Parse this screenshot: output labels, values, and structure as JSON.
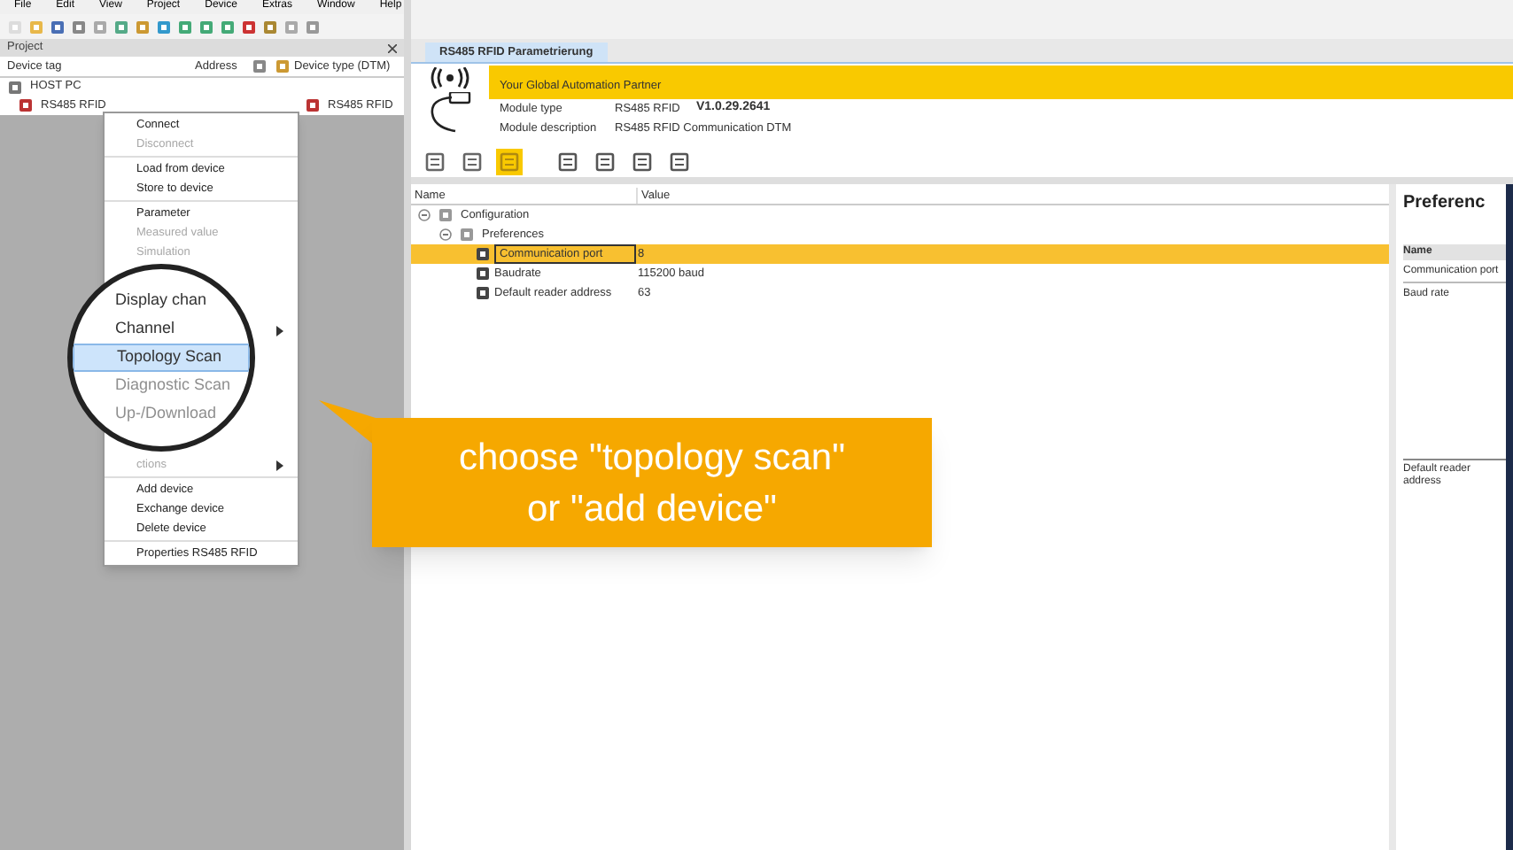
{
  "menu_bar": [
    "File",
    "Edit",
    "View",
    "Project",
    "Device",
    "Extras",
    "Window",
    "Help"
  ],
  "project_panel": {
    "title": "Project",
    "columns": [
      "Device tag",
      "Address",
      "Device type (DTM)"
    ],
    "tree": [
      {
        "tag": "HOST PC",
        "children": [
          {
            "tag": "RS485 RFID",
            "device_type": "RS485 RFID"
          }
        ]
      }
    ]
  },
  "context_menu": {
    "groups": [
      [
        {
          "label": "Connect",
          "disabled": false
        },
        {
          "label": "Disconnect",
          "disabled": true
        }
      ],
      [
        {
          "label": "Load from device",
          "disabled": false
        },
        {
          "label": "Store to device",
          "disabled": false
        }
      ],
      [
        {
          "label": "Parameter",
          "disabled": false
        },
        {
          "label": "Measured value",
          "disabled": true
        },
        {
          "label": "Simulation",
          "disabled": true
        }
      ]
    ],
    "hidden_row_submenu": true,
    "lower_groups": [
      [
        {
          "label": "ctions",
          "disabled": true,
          "submenu": true
        }
      ],
      [
        {
          "label": "Add device",
          "disabled": false
        },
        {
          "label": "Exchange device",
          "disabled": false
        },
        {
          "label": "Delete device",
          "disabled": false
        }
      ],
      [
        {
          "label": "Properties RS485 RFID",
          "disabled": false
        }
      ]
    ]
  },
  "magnifier": [
    {
      "label": "Display chan",
      "disabled": false,
      "selected": false
    },
    {
      "label": "Channel",
      "disabled": false,
      "selected": false
    },
    {
      "label": "Topology Scan",
      "disabled": false,
      "selected": true
    },
    {
      "label": "Diagnostic Scan",
      "disabled": true,
      "selected": false
    },
    {
      "label": "Up-/Download",
      "disabled": true,
      "selected": false
    }
  ],
  "callout": [
    "choose \"topology scan\"",
    "or \"add device\""
  ],
  "document_tab": {
    "title": "RS485 RFID Parametrierung",
    "selected": true
  },
  "dtm_header": {
    "banner": "Your Global Automation Partner",
    "fields": [
      {
        "label": "Module type",
        "value": "RS485 RFID",
        "version": "V1.0.29.2641"
      },
      {
        "label": "Module description",
        "value": "RS485 RFID Communication DTM"
      }
    ]
  },
  "toolbar": [
    {
      "selected": false
    },
    {
      "selected": false
    },
    {
      "selected": true
    },
    {
      "selected": false
    },
    {
      "selected": false
    },
    {
      "selected": false
    },
    {
      "selected": false
    }
  ],
  "parameter_table": {
    "columns": [
      "Name",
      "Value"
    ],
    "tree": [
      {
        "name": "Configuration",
        "expanded": true,
        "children": [
          {
            "name": "Preferences",
            "expanded": true,
            "children": [
              {
                "name": "Communication port",
                "value": "8",
                "selected": true
              },
              {
                "name": "Baudrate",
                "value": "115200 baud",
                "selected": false
              },
              {
                "name": "Default reader address",
                "value": "63",
                "selected": false
              }
            ]
          }
        ]
      }
    ]
  },
  "help_panel": {
    "title": "Preferenc",
    "header": "Name",
    "rows": [
      "Communication port",
      "Baud rate",
      "Default reader address"
    ]
  }
}
